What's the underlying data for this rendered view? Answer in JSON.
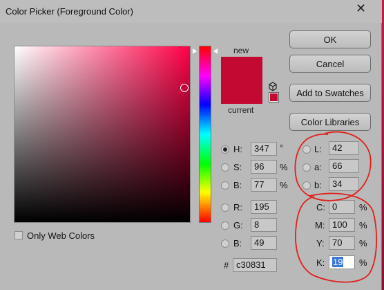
{
  "window": {
    "title": "Color Picker (Foreground Color)",
    "close_glyph": "✕"
  },
  "preview": {
    "new_label": "new",
    "current_label": "current",
    "new_color": "#c30831",
    "current_color": "#c30831"
  },
  "buttons": {
    "ok": "OK",
    "cancel": "Cancel",
    "add_to_swatches": "Add to Swatches",
    "color_libraries": "Color Libraries"
  },
  "hsb": {
    "h": {
      "label": "H:",
      "value": "347",
      "unit": "°",
      "selected": true
    },
    "s": {
      "label": "S:",
      "value": "96",
      "unit": "%"
    },
    "b": {
      "label": "B:",
      "value": "77",
      "unit": "%"
    }
  },
  "rgb": {
    "r": {
      "label": "R:",
      "value": "195"
    },
    "g": {
      "label": "G:",
      "value": "8"
    },
    "b": {
      "label": "B:",
      "value": "49"
    }
  },
  "lab": {
    "l": {
      "label": "L:",
      "value": "42"
    },
    "a": {
      "label": "a:",
      "value": "66"
    },
    "b": {
      "label": "b:",
      "value": "34"
    }
  },
  "cmyk": {
    "c": {
      "label": "C:",
      "value": "0",
      "unit": "%"
    },
    "m": {
      "label": "M:",
      "value": "100",
      "unit": "%"
    },
    "y": {
      "label": "Y:",
      "value": "70",
      "unit": "%"
    },
    "k": {
      "label": "K:",
      "value": "19",
      "unit": "%"
    }
  },
  "hex": {
    "label": "#",
    "value": "c30831"
  },
  "options": {
    "only_web_colors": "Only Web Colors",
    "only_web_colors_checked": false
  },
  "icons": {
    "close": "close-icon",
    "cube": "cube-icon",
    "gamut_warning": "gamut-swatch"
  },
  "annotation_color": "#e0201b"
}
